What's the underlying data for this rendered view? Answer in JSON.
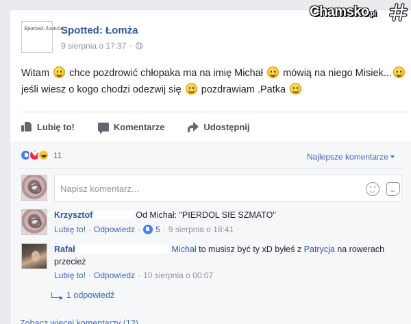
{
  "watermark": {
    "text": "Chamsko",
    "suffix": ".pl"
  },
  "page": {
    "avatar_text": "Spotted: Łomża",
    "name": "Spotted: Łomża",
    "timestamp": "9 sierpnia o 17:37",
    "meta_sep": "·",
    "privacy_icon": "globe-icon"
  },
  "post": {
    "parts": [
      "Witam ",
      " chce pozdrowić chłopaka ma na imię Michał ",
      " mówią na niego Misiek...",
      " jeśli wiesz o kogo chodzi odezwij się ",
      " pozdrawiam .Patka "
    ]
  },
  "actions": {
    "like": "Lubię to!",
    "comment": "Komentarze",
    "share": "Udostępnij"
  },
  "reactions": {
    "count": "11",
    "types": [
      "like",
      "love",
      "haha"
    ]
  },
  "sort": {
    "label": "Najlepsze komentarze"
  },
  "comment_input": {
    "placeholder": "Napisz komentarz..."
  },
  "comments": [
    {
      "author": "Krzysztof",
      "text": "Od Michał: \"PIERDOL SIE SZMATO\"",
      "like": "Lubię to!",
      "reply": "Odpowiedz",
      "sep": "·",
      "likes": "5",
      "time": "9 sierpnia o 18:41"
    },
    {
      "author": "Rafał",
      "mention1": "Michał",
      "text1": " to musisz być ty xD byłeś z ",
      "mention2": "Patrycja",
      "text2": " na rowerach przecież",
      "like": "Lubię to!",
      "reply": "Odpowiedz",
      "sep": "·",
      "time": "10 sierpnia o 00:07"
    }
  ],
  "replies_link": "1 odpowiedź",
  "more_comments": "Zobacz więcej komentarzy (12)",
  "colors": {
    "link": "#365899",
    "accent": "#4267b2",
    "background": "#e9ebee"
  }
}
